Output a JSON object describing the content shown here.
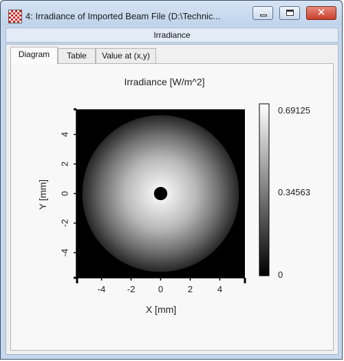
{
  "window": {
    "title": "4: Irradiance of Imported Beam File (D:\\Technic...",
    "header": "Irradiance"
  },
  "tabs": [
    {
      "label": "Diagram",
      "active": true
    },
    {
      "label": "Table",
      "active": false
    },
    {
      "label": "Value at (x,y)",
      "active": false
    }
  ],
  "chart_data": {
    "type": "heatmap",
    "title": "Irradiance   [W/m^2]",
    "xlabel": "X [mm]",
    "ylabel": "Y [mm]",
    "xlim": [
      -5.7,
      5.7
    ],
    "ylim": [
      -5.7,
      5.7
    ],
    "xticks": [
      "-4",
      "-2",
      "0",
      "2",
      "4"
    ],
    "yticks": [
      "4",
      "2",
      "0",
      "-2",
      "-4"
    ],
    "colorbar": {
      "max_label": "0.69125",
      "mid_label": "0.34563",
      "min_label": "0",
      "min": 0,
      "max": 0.69125,
      "colormap": "grayscale"
    },
    "distribution": {
      "shape": "annular",
      "outer_radius_mm": 5.3,
      "inner_hole_radius_mm": 0.45,
      "peak_value": 0.69125,
      "edge_value": 0.05
    }
  },
  "colors": {
    "background": "#000000",
    "peak": "#ffffff"
  }
}
